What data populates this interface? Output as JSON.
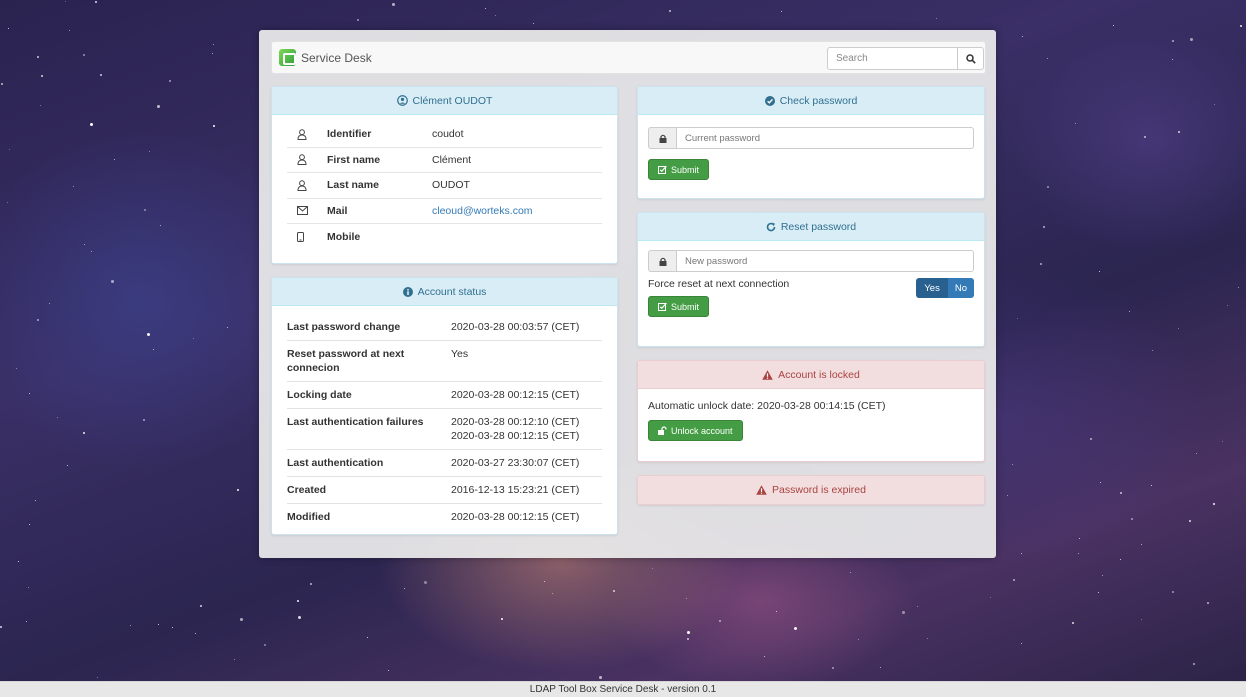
{
  "navbar": {
    "brand": "Service Desk",
    "search_placeholder": "Search"
  },
  "identity": {
    "title": "Clément OUDOT",
    "rows": [
      {
        "icon": "user-icon",
        "label": "Identifier",
        "value": "coudot"
      },
      {
        "icon": "user-icon",
        "label": "First name",
        "value": "Clément"
      },
      {
        "icon": "user-icon",
        "label": "Last name",
        "value": "OUDOT"
      },
      {
        "icon": "envelope-icon",
        "label": "Mail",
        "value": "cleoud@worteks.com"
      },
      {
        "icon": "mobile-icon",
        "label": "Mobile",
        "value": ""
      }
    ]
  },
  "account_status": {
    "title": "Account status",
    "rows": [
      {
        "label": "Last password change",
        "value": "2020-03-28 00:03:57 (CET)"
      },
      {
        "label": "Reset password at next connecion",
        "value": "Yes"
      },
      {
        "label": "Locking date",
        "value": "2020-03-28 00:12:15 (CET)"
      },
      {
        "label": "Last authentication failures",
        "value": "2020-03-28 00:12:10 (CET)",
        "value2": "2020-03-28 00:12:15 (CET)"
      },
      {
        "label": "Last authentication",
        "value": "2020-03-27 23:30:07 (CET)"
      },
      {
        "label": "Created",
        "value": "2016-12-13 15:23:21 (CET)"
      },
      {
        "label": "Modified",
        "value": "2020-03-28 00:12:15 (CET)"
      }
    ]
  },
  "check_password": {
    "title": "Check password",
    "placeholder": "Current password",
    "submit": "Submit"
  },
  "reset_password": {
    "title": "Reset password",
    "placeholder": "New password",
    "force_label": "Force reset at next connection",
    "yes": "Yes",
    "no": "No",
    "submit": "Submit"
  },
  "locked": {
    "title": "Account is locked",
    "unlock_text": "Automatic unlock date: 2020-03-28 00:14:15 (CET)",
    "unlock_button": "Unlock account"
  },
  "expired": {
    "title": "Password is expired"
  },
  "footer": "LDAP Tool Box Service Desk - version 0.1",
  "colors": {
    "info_bg": "#d9edf7",
    "info_text": "#31708f",
    "danger_bg": "#f2dede",
    "danger_text": "#a94442",
    "success": "#449d44",
    "primary": "#337ab7"
  }
}
